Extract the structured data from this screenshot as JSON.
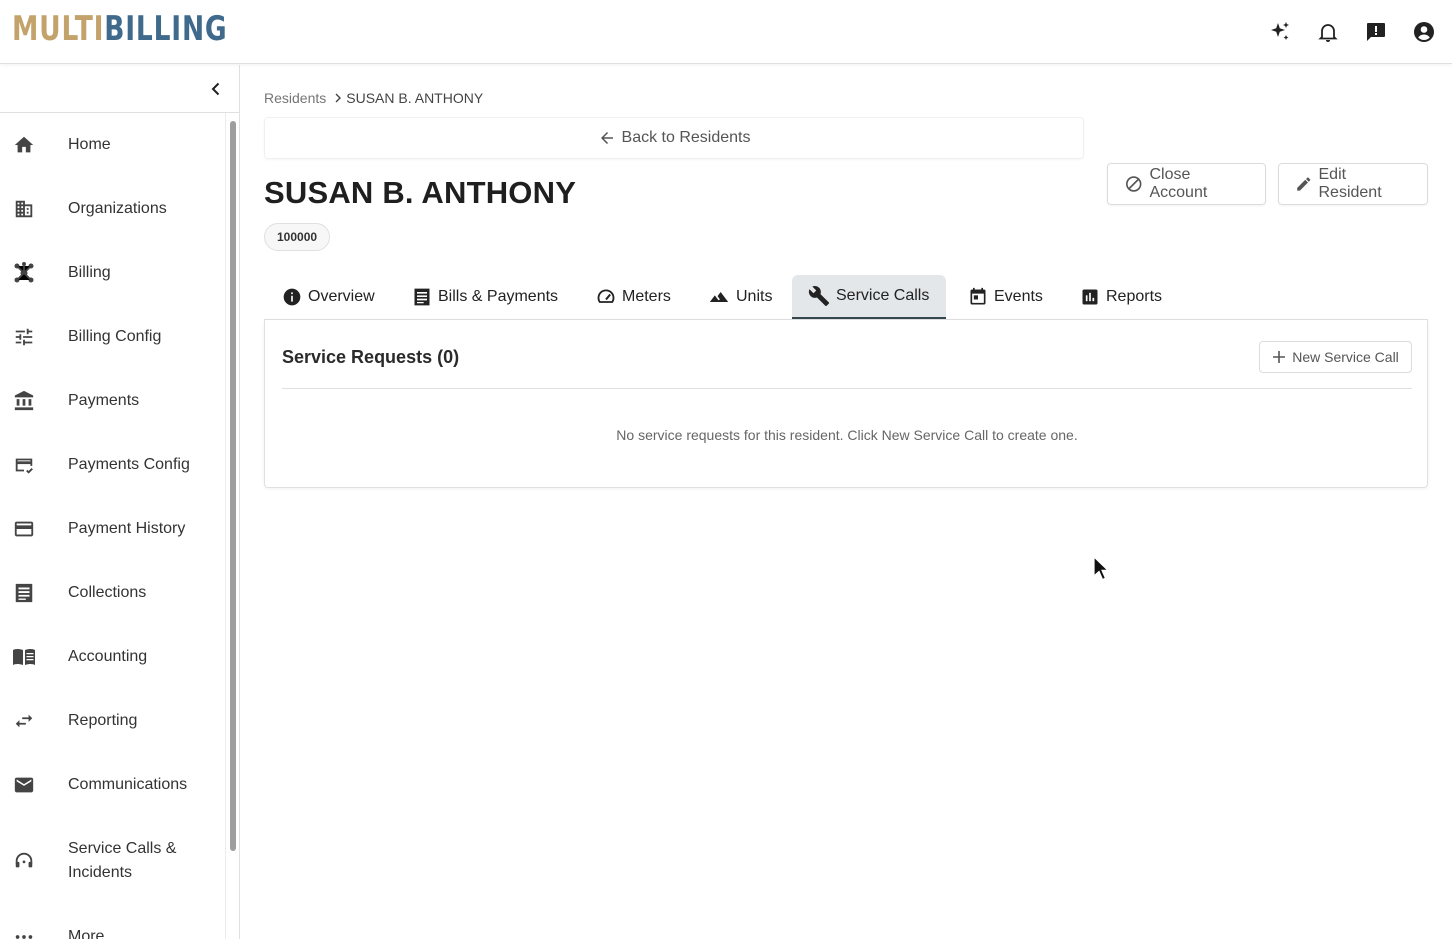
{
  "app": {
    "logo_part1": "MULTI",
    "logo_part2": "BILLING"
  },
  "topbar_icons": [
    "sparkle-icon",
    "bell-icon",
    "feedback-icon",
    "account-circle-icon"
  ],
  "sidebar": {
    "items": [
      {
        "label": "Home",
        "icon": "home-icon"
      },
      {
        "label": "Organizations",
        "icon": "building-icon"
      },
      {
        "label": "Billing",
        "icon": "hub-icon"
      },
      {
        "label": "Billing Config",
        "icon": "tune-icon"
      },
      {
        "label": "Payments",
        "icon": "bank-icon"
      },
      {
        "label": "Payments Config",
        "icon": "card-check-icon"
      },
      {
        "label": "Payment History",
        "icon": "credit-card-icon"
      },
      {
        "label": "Collections",
        "icon": "list-icon"
      },
      {
        "label": "Accounting",
        "icon": "book-icon"
      },
      {
        "label": "Reporting",
        "icon": "swap-icon"
      },
      {
        "label": "Communications",
        "icon": "mail-icon"
      },
      {
        "label": "Service Calls & Incidents",
        "icon": "headset-icon"
      },
      {
        "label": "More",
        "icon": "more-icon"
      }
    ]
  },
  "breadcrumb": {
    "parent": "Residents",
    "current": "SUSAN B. ANTHONY"
  },
  "back_link": "Back to Residents",
  "resident": {
    "name": "SUSAN B. ANTHONY",
    "account_number": "100000"
  },
  "actions": {
    "close_account": "Close Account",
    "edit_resident": "Edit Resident"
  },
  "tabs": [
    {
      "label": "Overview",
      "icon": "info-icon"
    },
    {
      "label": "Bills & Payments",
      "icon": "receipt-icon"
    },
    {
      "label": "Meters",
      "icon": "speed-icon"
    },
    {
      "label": "Units",
      "icon": "terrain-icon"
    },
    {
      "label": "Service Calls",
      "icon": "wrench-icon",
      "active": true
    },
    {
      "label": "Events",
      "icon": "calendar-icon"
    },
    {
      "label": "Reports",
      "icon": "bar-chart-icon"
    }
  ],
  "service_panel": {
    "title": "Service Requests (0)",
    "new_button": "New Service Call",
    "empty_message": "No service requests for this resident. Click New Service Call to create one."
  },
  "colors": {
    "logo_gold": "#c3a36b",
    "logo_blue": "#3f6a8c",
    "active_tab_bg": "#e3e7ea",
    "active_tab_border": "#37474f"
  }
}
